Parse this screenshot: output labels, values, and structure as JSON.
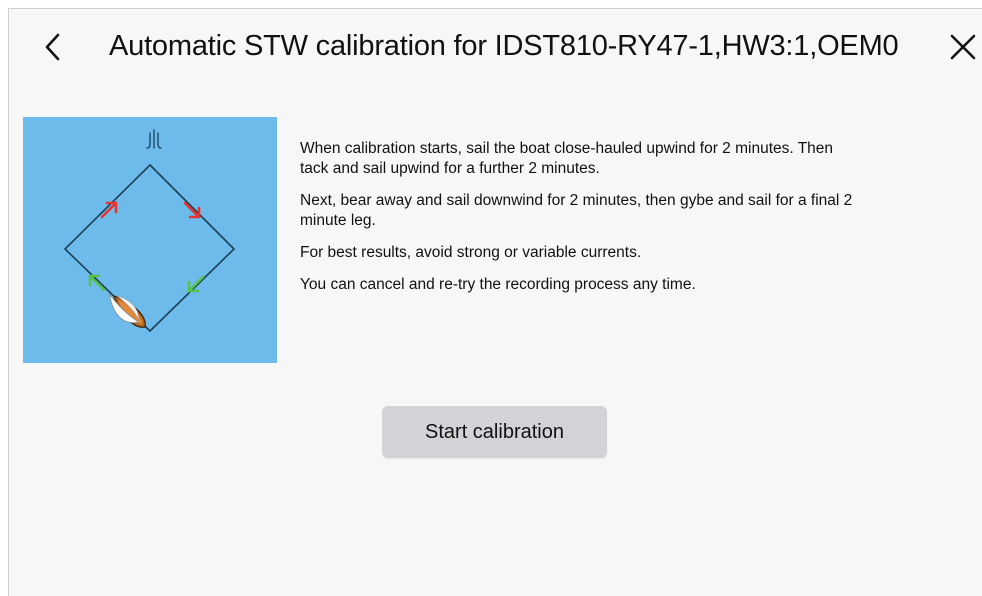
{
  "header": {
    "title": "Automatic STW calibration for IDST810-RY47-1,HW3:1,OEM0",
    "back_icon": "chevron-left-icon",
    "close_icon": "close-icon"
  },
  "illustration": {
    "background_color": "#6cbbea",
    "icons": [
      "wind-icon",
      "boat-icon",
      "arrow-icon"
    ],
    "arrow_colors": {
      "upwind": "#e8332e",
      "downwind": "#58c24a"
    }
  },
  "instructions": {
    "paragraphs": [
      "When calibration starts, sail the boat close-hauled upwind for 2 minutes. Then tack and sail upwind for a further 2 minutes.",
      "Next, bear away and sail downwind for 2 minutes, then gybe and sail for a final 2 minute leg.",
      "For best results, avoid strong or variable currents.",
      "You can cancel and re-try the recording process any time."
    ]
  },
  "actions": {
    "start_label": "Start calibration"
  }
}
